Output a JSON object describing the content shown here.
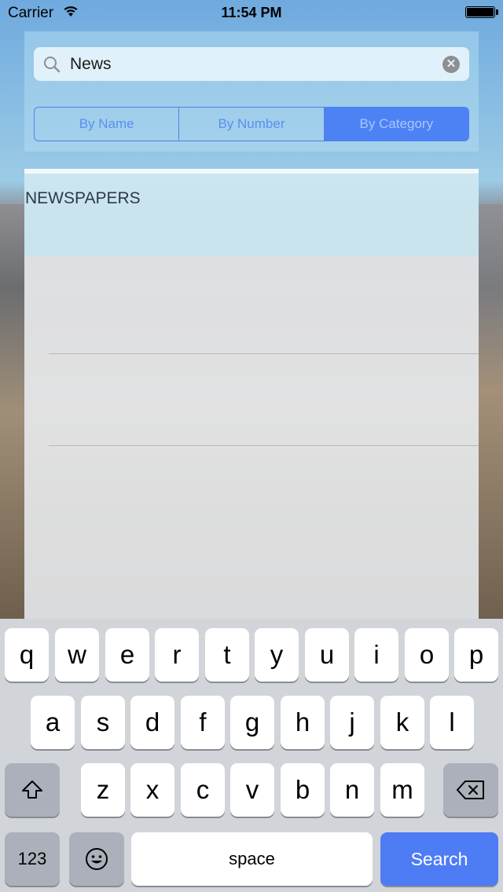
{
  "status_bar": {
    "carrier": "Carrier",
    "time": "11:54 PM"
  },
  "search": {
    "value": "News",
    "placeholder": ""
  },
  "segments": [
    {
      "label": "By Name",
      "active": false
    },
    {
      "label": "By Number",
      "active": false
    },
    {
      "label": "By Category",
      "active": true
    }
  ],
  "results": {
    "section_title": "NEWSPAPERS"
  },
  "keyboard": {
    "row1": [
      "q",
      "w",
      "e",
      "r",
      "t",
      "y",
      "u",
      "i",
      "o",
      "p"
    ],
    "row2": [
      "a",
      "s",
      "d",
      "f",
      "g",
      "h",
      "j",
      "k",
      "l"
    ],
    "row3": [
      "z",
      "x",
      "c",
      "v",
      "b",
      "n",
      "m"
    ],
    "numbers_label": "123",
    "space_label": "space",
    "search_label": "Search"
  },
  "colors": {
    "accent": "#4d82f5",
    "segment_text": "#5b8ef0",
    "keyboard_bg": "#d1d4d9"
  }
}
